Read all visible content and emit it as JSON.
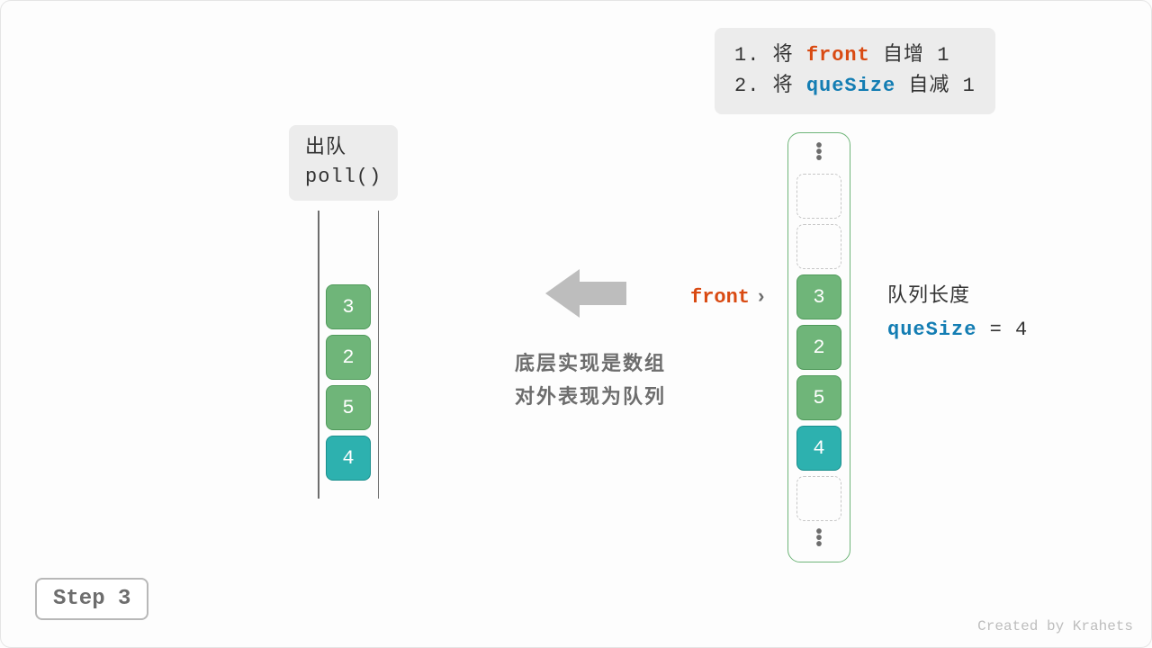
{
  "steps": {
    "line1_prefix": "1. 将 ",
    "line1_kw": "front",
    "line1_suffix": " 自增 1",
    "line2_prefix": "2. 将 ",
    "line2_kw": "queSize",
    "line2_suffix": " 自减 1"
  },
  "poll": {
    "line1": "出队",
    "line2": "poll()"
  },
  "queue": {
    "items": [
      "3",
      "2",
      "5",
      "4"
    ]
  },
  "caption": {
    "line1": "底层实现是数组",
    "line2": "对外表现为队列"
  },
  "array": {
    "slots": [
      {
        "kind": "empty"
      },
      {
        "kind": "empty"
      },
      {
        "kind": "green",
        "val": "3"
      },
      {
        "kind": "green",
        "val": "2"
      },
      {
        "kind": "green",
        "val": "5"
      },
      {
        "kind": "teal",
        "val": "4"
      },
      {
        "kind": "empty"
      }
    ]
  },
  "front": {
    "label": "front",
    "chev": "›"
  },
  "size": {
    "label": "队列长度",
    "kw": "queSize",
    "eq": " = ",
    "val": "4"
  },
  "step_badge": "Step 3",
  "credit": "Created by Krahets",
  "colors": {
    "green": "#6fb579",
    "teal": "#2db1af",
    "front": "#d94a12",
    "que": "#137db3",
    "gray": "#6d6d6d"
  }
}
